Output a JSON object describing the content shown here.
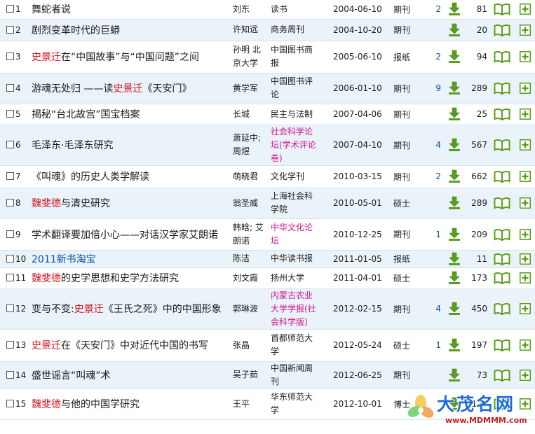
{
  "rows": [
    {
      "no": "1",
      "title": [
        {
          "t": "舞蛇者说",
          "hl": false
        }
      ],
      "author": [
        "刘东"
      ],
      "source": [
        "读书"
      ],
      "date": "2004-06-10",
      "type": "期刊",
      "cite": "2",
      "dl": "81"
    },
    {
      "no": "2",
      "title": [
        {
          "t": "剧烈变革时代的巨蟒",
          "hl": false
        }
      ],
      "author": [
        "许知远"
      ],
      "source": [
        "商务周刊"
      ],
      "date": "2004-10-20",
      "type": "期刊",
      "cite": "",
      "dl": "20"
    },
    {
      "no": "3",
      "title": [
        {
          "t": "史景迁",
          "hl": true
        },
        {
          "t": "在“中国故事”与“中国问题”之间",
          "hl": false
        }
      ],
      "author": [
        "孙明 北",
        "京大学"
      ],
      "source": [
        "中国图书商",
        "报"
      ],
      "date": "2005-06-10",
      "type": "报纸",
      "cite": "2",
      "dl": "94"
    },
    {
      "no": "4",
      "title": [
        {
          "t": "游魂无处归 ——读",
          "hl": false
        },
        {
          "t": "史景迁",
          "hl": true
        },
        {
          "t": "《天安门》",
          "hl": false
        }
      ],
      "author": [
        "黄学军"
      ],
      "source": [
        "中国图书评",
        "论"
      ],
      "date": "2006-01-10",
      "type": "期刊",
      "cite": "9",
      "dl": "289"
    },
    {
      "no": "5",
      "title": [
        {
          "t": "揭秘“台北故宫”国宝档案",
          "hl": false
        }
      ],
      "author": [
        "长城"
      ],
      "source": [
        "民主与法制"
      ],
      "date": "2007-04-06",
      "type": "期刊",
      "cite": "",
      "dl": "25"
    },
    {
      "no": "6",
      "title": [
        {
          "t": "毛泽东·毛泽东研究",
          "hl": false
        }
      ],
      "author": [
        "萧延中;",
        "周煜"
      ],
      "source": [
        "社会科学论",
        "坛(学术评论",
        "卷)"
      ],
      "source_color": "#d0148c",
      "date": "2007-04-10",
      "type": "期刊",
      "cite": "4",
      "dl": "567"
    },
    {
      "no": "7",
      "title": [
        {
          "t": "《叫魂》的历史人类学解读",
          "hl": false
        }
      ],
      "author": [
        "萌晓君"
      ],
      "source": [
        "文化学刊"
      ],
      "date": "2010-03-15",
      "type": "期刊",
      "cite": "2",
      "dl": "662"
    },
    {
      "no": "8",
      "title": [
        {
          "t": "魏斐德",
          "hl": true
        },
        {
          "t": "与清史研究",
          "hl": false
        }
      ],
      "author": [
        "翁圣威"
      ],
      "source": [
        "上海社会科",
        "学院"
      ],
      "date": "2010-05-01",
      "type": "硕士",
      "cite": "",
      "dl": "289"
    },
    {
      "no": "9",
      "title": [
        {
          "t": "学术翻译要加倍小心——对话汉学家艾朗诺",
          "hl": false
        }
      ],
      "author": [
        "韩晗; 艾",
        "朗诺"
      ],
      "source": [
        "中华文化论",
        "坛"
      ],
      "source_color": "#d0148c",
      "date": "2010-12-25",
      "type": "期刊",
      "cite": "1",
      "dl": "209"
    },
    {
      "no": "10",
      "title": [
        {
          "t": "2011新书淘宝",
          "hl": false
        }
      ],
      "title_color": "#0a4fa6",
      "author": [
        "陈洁"
      ],
      "source": [
        "中华读书报"
      ],
      "date": "2011-01-05",
      "type": "报纸",
      "cite": "",
      "dl": "11"
    },
    {
      "no": "11",
      "title": [
        {
          "t": "魏斐德",
          "hl": true
        },
        {
          "t": "的史学思想和史学方法研究",
          "hl": false
        }
      ],
      "author": [
        "刘文霞"
      ],
      "source": [
        "扬州大学"
      ],
      "date": "2011-04-01",
      "type": "硕士",
      "cite": "",
      "dl": "173"
    },
    {
      "no": "12",
      "title": [
        {
          "t": "变与不变:",
          "hl": false
        },
        {
          "t": "史景迁",
          "hl": true
        },
        {
          "t": "《王氏之死》中的中国形象",
          "hl": false
        }
      ],
      "author": [
        "郭琳波"
      ],
      "source": [
        "内蒙古农业",
        "大学学报(社",
        "会科学版)"
      ],
      "source_color": "#d0148c",
      "date": "2012-02-15",
      "type": "期刊",
      "cite": "4",
      "dl": "450"
    },
    {
      "no": "13",
      "title": [
        {
          "t": "史景迁",
          "hl": true
        },
        {
          "t": "在《天安门》中对近代中国的书写",
          "hl": false
        }
      ],
      "author": [
        "张晶"
      ],
      "source": [
        "首都师范大",
        "学"
      ],
      "date": "2012-05-24",
      "type": "硕士",
      "cite": "1",
      "dl": "197"
    },
    {
      "no": "14",
      "title": [
        {
          "t": "盛世谣言“叫魂”术",
          "hl": false
        }
      ],
      "author": [
        "吴子茹"
      ],
      "source": [
        "中国新闻周",
        "刊"
      ],
      "date": "2012-06-25",
      "type": "期刊",
      "cite": "",
      "dl": "73"
    },
    {
      "no": "15",
      "title": [
        {
          "t": "魏斐德",
          "hl": true
        },
        {
          "t": "与他的中国学研究",
          "hl": false
        }
      ],
      "author": [
        "王平"
      ],
      "source": [
        "华东师范大",
        "学"
      ],
      "date": "2012-10-01",
      "type": "博士",
      "cite": "",
      "dl": "1176"
    }
  ],
  "row_heights": [
    27,
    31,
    46,
    44,
    30,
    58,
    32,
    44,
    45,
    25,
    30,
    58,
    46,
    33,
    44
  ],
  "watermark": {
    "cn": "大茂名网",
    "url": "www.MDMMM.com"
  },
  "colors": {
    "link": "#0a4fa6",
    "keyword": "#d0141b",
    "pink_source": "#d0148c",
    "row_alt": "#eaf2fa",
    "icon_green": "#5a9e1e"
  },
  "icons": {
    "download": "download-arrow-icon",
    "read": "open-book-icon",
    "add": "add-plus-icon"
  }
}
